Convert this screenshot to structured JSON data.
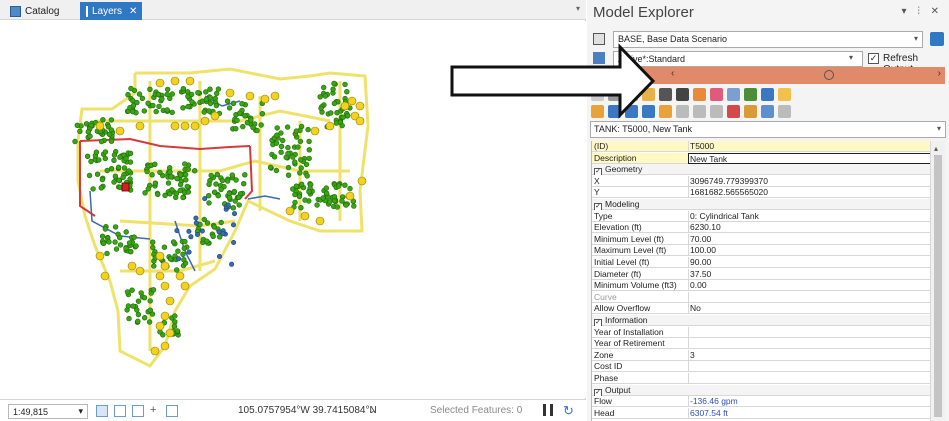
{
  "tabs": {
    "catalog": "Catalog",
    "layers": "Layers",
    "close_glyph": "✕",
    "overflow_glyph": "▾"
  },
  "status": {
    "scale": "1:49,815",
    "coords": "105.0757954°W 39.7415084°N",
    "coords_arrow": "⌄",
    "selected_features": "Selected Features: 0"
  },
  "model_explorer": {
    "title": "Model Explorer",
    "controls": "▾ ⫶ ✕",
    "scenario": "BASE, Base Data Scenario",
    "attribute_view": "Active*:Standard",
    "refresh_output_label": "Refresh Output",
    "refresh_output_checked": true,
    "nav_left": "‹",
    "nav_right": "›",
    "selected_element": "TANK: T5000, New Tank"
  },
  "properties": [
    {
      "label": "(ID)",
      "value": "T5000",
      "kind": "yellow"
    },
    {
      "label": "Description",
      "value": "New Tank",
      "kind": "yellow-sel"
    },
    {
      "label": "Geometry",
      "value": "",
      "kind": "cat"
    },
    {
      "label": "X",
      "value": "3096749.779399370",
      "kind": ""
    },
    {
      "label": "Y",
      "value": "1681682.565565020",
      "kind": ""
    },
    {
      "label": "Modeling",
      "value": "",
      "kind": "cat"
    },
    {
      "label": "Type",
      "value": "0: Cylindrical Tank",
      "kind": ""
    },
    {
      "label": "Elevation (ft)",
      "value": "6230.10",
      "kind": ""
    },
    {
      "label": "Minimum Level (ft)",
      "value": "70.00",
      "kind": ""
    },
    {
      "label": "Maximum Level (ft)",
      "value": "100.00",
      "kind": ""
    },
    {
      "label": "Initial Level (ft)",
      "value": "90.00",
      "kind": ""
    },
    {
      "label": "Diameter (ft)",
      "value": "37.50",
      "kind": ""
    },
    {
      "label": "Minimum Volume (ft3)",
      "value": "0.00",
      "kind": ""
    },
    {
      "label": "Curve",
      "value": "",
      "kind": "grey"
    },
    {
      "label": "Allow Overflow",
      "value": "No",
      "kind": ""
    },
    {
      "label": "Information",
      "value": "",
      "kind": "cat"
    },
    {
      "label": "Year of Installation",
      "value": "",
      "kind": ""
    },
    {
      "label": "Year of Retirement",
      "value": "",
      "kind": ""
    },
    {
      "label": "Zone",
      "value": "3",
      "kind": ""
    },
    {
      "label": "Cost ID",
      "value": "",
      "kind": ""
    },
    {
      "label": "Phase",
      "value": "",
      "kind": ""
    },
    {
      "label": "Output",
      "value": "",
      "kind": "cat"
    },
    {
      "label": "Flow",
      "value": "-136.46 gpm",
      "kind": "blue"
    },
    {
      "label": "Head",
      "value": "6307.54 ft",
      "kind": "blue"
    }
  ],
  "colors": {
    "accent": "#2f78c4",
    "junction": "#3aa512",
    "tank": "#f4d21b",
    "pipe": "#efe26a",
    "highlight": "#e08a6a"
  }
}
